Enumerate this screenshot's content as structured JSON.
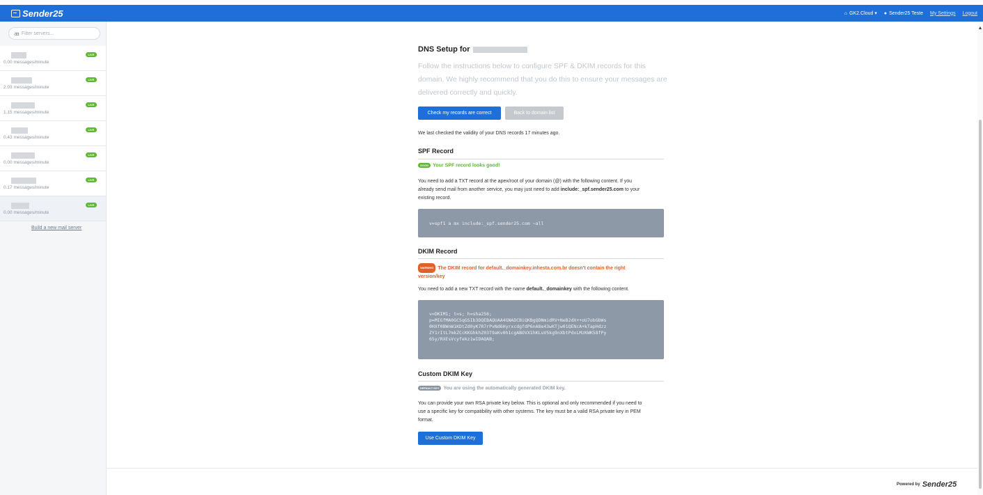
{
  "header": {
    "brand": "Sender25",
    "org_label": "GK2.Cloud ▾",
    "user_label": "Sender25 Teste",
    "settings_link": "My Settings",
    "logout_link": "Logout"
  },
  "sidebar": {
    "filter_placeholder": "Filter servers...",
    "servers": [
      {
        "rate": "0.00 messages/minute",
        "status": "LIVE"
      },
      {
        "rate": "2.03 messages/minute",
        "status": "LIVE"
      },
      {
        "rate": "1.15 messages/minute",
        "status": "LIVE"
      },
      {
        "rate": "0.43 messages/minute",
        "status": "LIVE"
      },
      {
        "rate": "0.00 messages/minute",
        "status": "LIVE"
      },
      {
        "rate": "0.17 messages/minute",
        "status": "LIVE"
      },
      {
        "rate": "0.00 messages/minute",
        "status": "LIVE"
      }
    ],
    "build_link": "Build a new mail server"
  },
  "main": {
    "title": "DNS Setup for",
    "intro": "Follow the instructions below to configure SPF & DKIM records for this domain. We highly recommend that you do this to ensure your messages are delivered correctly and quickly.",
    "check_button": "Check my records are correct",
    "back_button": "Back to domain list",
    "last_checked": "We last checked the validity of your DNS records 17 minutes ago.",
    "spf": {
      "heading": "SPF Record",
      "badge": "GOOD",
      "status": "Your SPF record looks good!",
      "desc_1": "You need to add a TXT record at the apex/root of your domain (@) with the following content. If you",
      "desc_2_pre": "already send mail from another service, you may just need to add ",
      "desc_2_bold": "include:_spf.sender25.com",
      "desc_2_post": " to your",
      "desc_3": "existing record.",
      "record": "v=spf1 a mx include:_spf.sender25.com ~all"
    },
    "dkim": {
      "heading": "DKIM Record",
      "badge": "WARNING",
      "status_1": "The DKIM record for default._domainkey.inhesta.com.br doesn't contain the right",
      "status_2": "version/key",
      "desc_pre": "You need to add a new TXT record with the name ",
      "desc_bold": "default._domainkey",
      "desc_post": " with the following content.",
      "record_lines": [
        "v=DKIM1; t=s; h=sha256;",
        "p=MIGfMA0GCSqGSIb3DQEBAQUAA4GNADCBiQKBgQDNmidRV+NeB2dX++oU7obGbWs",
        "0HXf0BWnW1KDtZd0yK7R7rPvNd6HyrxcdgfdP6nA8e43wKTjw01QENcA+kTapHdzz",
        "ZY1rItL7mkZCcKKGhkhZ03T9aKv0h1cgABOVX1hKLuV5kg9nXbtPdxLMzKWK58fPy",
        "65y/RXEsVcyfekz1wIDAQAB;"
      ]
    },
    "custom_dkim": {
      "heading": "Custom DKIM Key",
      "badge": "DEFAULT KEY",
      "status": "You are using the automatically generated DKIM key.",
      "desc_1": "You can provide your own RSA private key below. This is optional and only recommended if you need to",
      "desc_2": "use a specific key for compatibility with other systems. The key must be a valid RSA private key in PEM",
      "desc_3": "format.",
      "button": "Use Custom DKIM Key"
    }
  },
  "footer": {
    "powered_by": "Powered by",
    "brand": "Sender25"
  },
  "colors": {
    "accent": "#1e6fd9",
    "good": "#5fb832",
    "warning": "#e0622a",
    "code_bg": "#8e99a8"
  }
}
